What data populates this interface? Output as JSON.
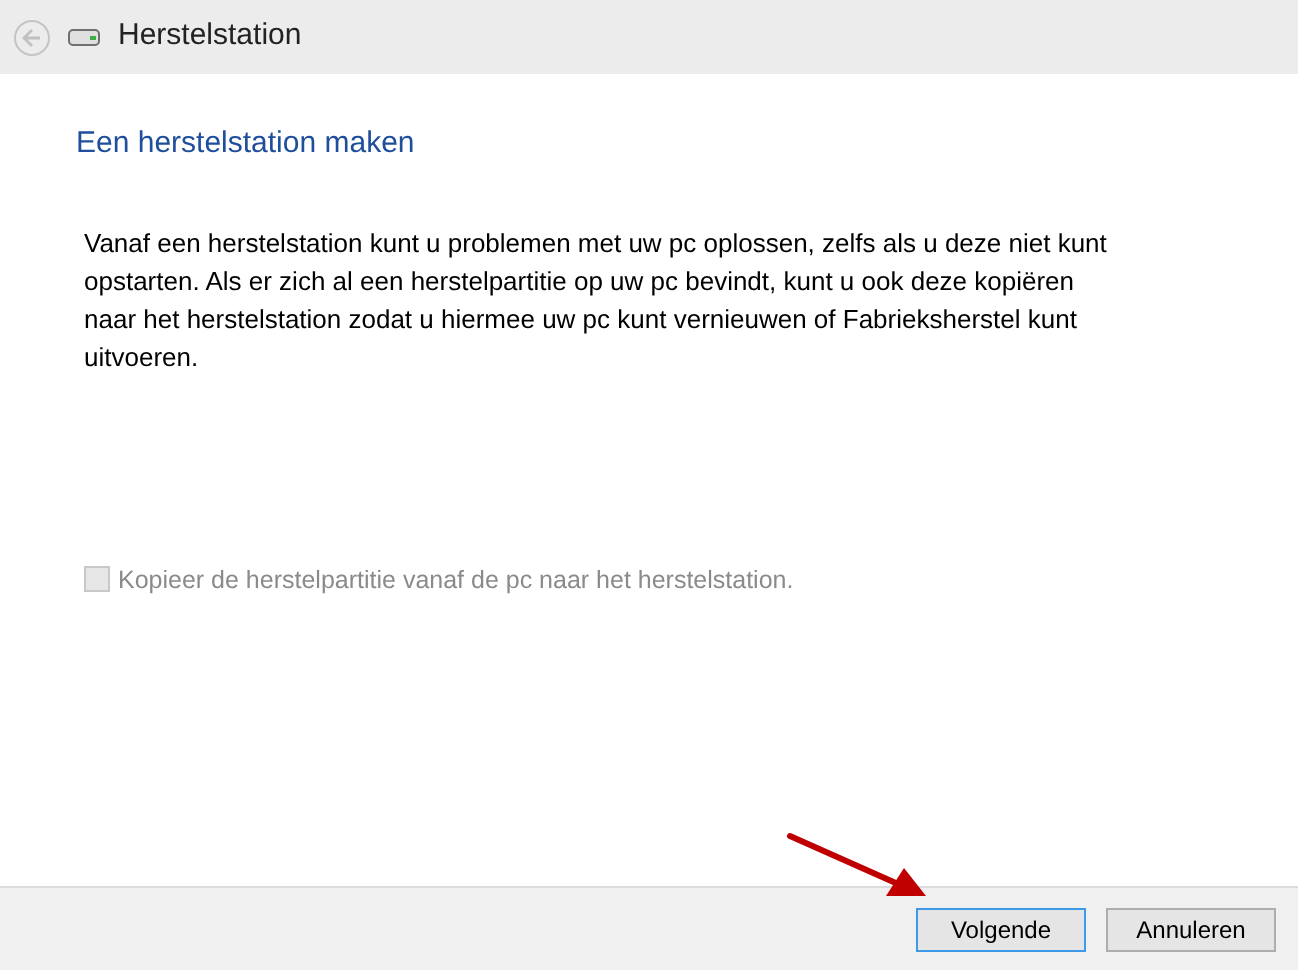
{
  "window": {
    "title": "Herstelstation"
  },
  "heading": "Een herstelstation maken",
  "description": "Vanaf een herstelstation kunt u problemen met uw pc oplossen, zelfs als u deze niet kunt opstarten. Als er zich al een herstelpartitie op uw pc bevindt, kunt u ook deze kopiëren naar het herstelstation zodat u hiermee uw pc kunt vernieuwen of Fabrieksherstel kunt uitvoeren.",
  "option": {
    "label": "Kopieer de herstelpartitie vanaf de pc naar het herstelstation.",
    "checked": false,
    "disabled": true
  },
  "buttons": [
    {
      "label": "Volgende",
      "focused": true
    },
    {
      "label": "Annuleren",
      "focused": false
    }
  ]
}
